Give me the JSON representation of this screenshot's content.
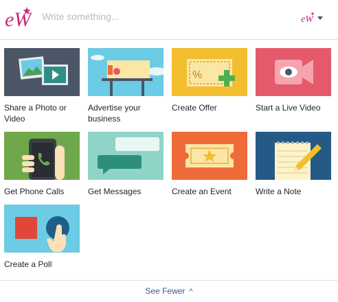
{
  "composer": {
    "placeholder": "Write something...",
    "logo_text": "eW"
  },
  "options": [
    {
      "label": "Share a Photo or Video",
      "icon": "photo-video-icon",
      "bg": "#4b5766"
    },
    {
      "label": "Advertise your business",
      "icon": "billboard-icon",
      "bg": "#6ccbe5"
    },
    {
      "label": "Create Offer",
      "icon": "offer-coupon-icon",
      "bg": "#f2be2e"
    },
    {
      "label": "Start a Live Video",
      "icon": "live-video-camera-icon",
      "bg": "#e45a6a"
    },
    {
      "label": "Get Phone Calls",
      "icon": "phone-call-icon",
      "bg": "#6fa84a"
    },
    {
      "label": "Get Messages",
      "icon": "message-bubbles-icon",
      "bg": "#8fd4c6"
    },
    {
      "label": "Create an Event",
      "icon": "event-ticket-icon",
      "bg": "#ef6a39"
    },
    {
      "label": "Write a Note",
      "icon": "note-pencil-icon",
      "bg": "#245a85"
    },
    {
      "label": "Create a Poll",
      "icon": "poll-icon",
      "bg": "#6ccbe5"
    }
  ],
  "footer": {
    "see_fewer_label": "See Fewer",
    "chevron": "^"
  },
  "colors": {
    "brand_pink": "#c8297b",
    "link_blue": "#365899"
  }
}
